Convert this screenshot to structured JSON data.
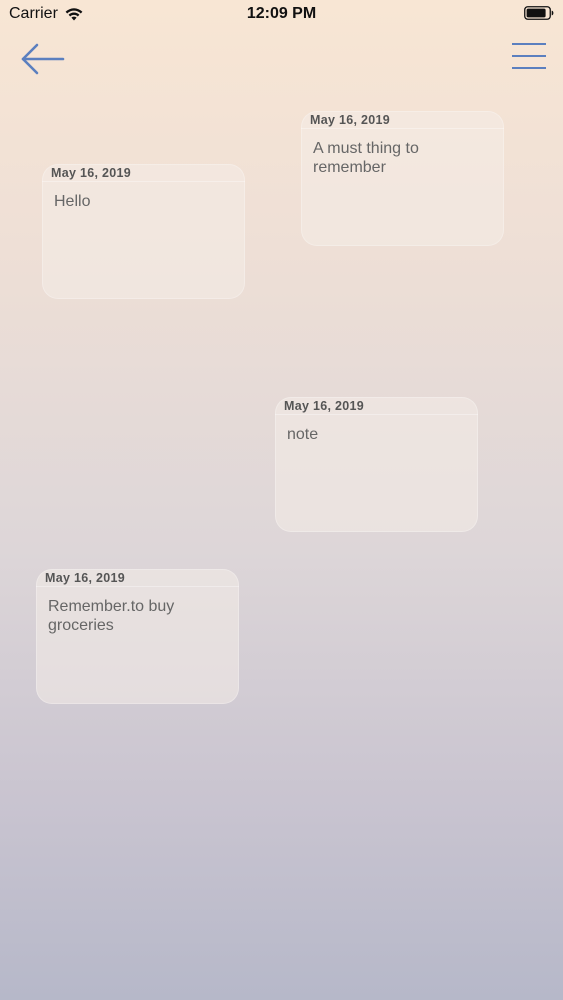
{
  "status_bar": {
    "carrier": "Carrier",
    "time": "12:09 PM"
  },
  "nav": {
    "back_icon": "arrow-left-icon",
    "menu_icon": "hamburger-menu-icon",
    "accent_color": "#5b7fbf"
  },
  "notes": [
    {
      "date": "May 16, 2019",
      "text": "A must thing to remember"
    },
    {
      "date": "May 16, 2019",
      "text": "Hello"
    },
    {
      "date": "May 16, 2019",
      "text": "note"
    },
    {
      "date": "May 16, 2019",
      "text": "Remember.to buy groceries"
    }
  ]
}
